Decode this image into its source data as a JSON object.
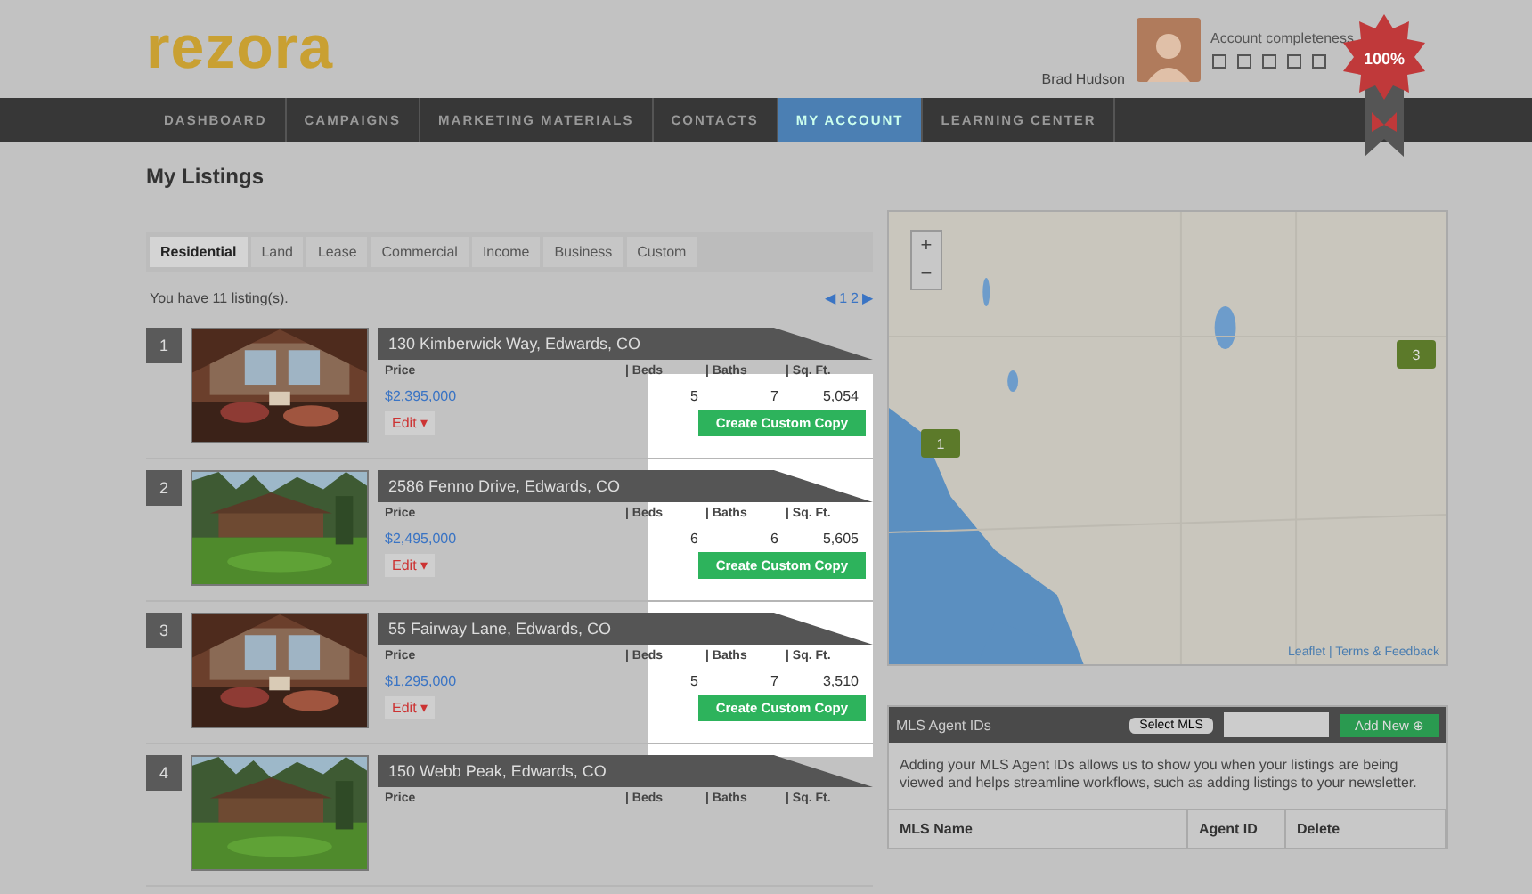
{
  "header": {
    "logo": "rezora",
    "user_name": "Brad Hudson",
    "completeness_label": "Account completeness",
    "badge": "100%"
  },
  "nav": [
    {
      "label": "DASHBOARD",
      "selected": false
    },
    {
      "label": "CAMPAIGNS",
      "selected": false
    },
    {
      "label": "MARKETING MATERIALS",
      "selected": false
    },
    {
      "label": "CONTACTS",
      "selected": false
    },
    {
      "label": "MY ACCOUNT",
      "selected": true
    },
    {
      "label": "LEARNING CENTER",
      "selected": false
    }
  ],
  "page_title": "My Listings",
  "tabs": [
    {
      "label": "Residential",
      "selected": true
    },
    {
      "label": "Land",
      "selected": false
    },
    {
      "label": "Lease",
      "selected": false
    },
    {
      "label": "Commercial",
      "selected": false
    },
    {
      "label": "Income",
      "selected": false
    },
    {
      "label": "Business",
      "selected": false
    },
    {
      "label": "Custom",
      "selected": false
    }
  ],
  "listing_count": "You have 11 listing(s).",
  "pagination": {
    "prev": "◀",
    "pages": [
      "1",
      "2"
    ],
    "next": "▶"
  },
  "listings": [
    {
      "number": "1",
      "address": "130 Kimberwick Way, Edwards, CO",
      "columns": [
        "Price",
        "| Beds",
        "| Baths",
        "| Sq. Ft."
      ],
      "price": "$2,395,000",
      "beds": "5",
      "baths": "7",
      "sqft": "5,054",
      "edit": "Edit ▾",
      "action": "Create Custom Copy"
    },
    {
      "number": "2",
      "address": "2586 Fenno Drive, Edwards, CO",
      "columns": [
        "Price",
        "| Beds",
        "| Baths",
        "| Sq. Ft."
      ],
      "price": "$2,495,000",
      "beds": "6",
      "baths": "6",
      "sqft": "5,605",
      "edit": "Edit ▾",
      "action": "Create Custom Copy"
    },
    {
      "number": "3",
      "address": "55 Fairway Lane, Edwards, CO",
      "columns": [
        "Price",
        "| Beds",
        "| Baths",
        "| Sq. Ft."
      ],
      "price": "$1,295,000",
      "beds": "5",
      "baths": "7",
      "sqft": "3,510",
      "edit": "Edit ▾",
      "action": "Create Custom Copy"
    },
    {
      "number": "4",
      "address": "150 Webb Peak, Edwards, CO",
      "columns": [
        "Price",
        "| Beds",
        "| Baths",
        "| Sq. Ft."
      ]
    }
  ],
  "map": {
    "zoom_in": "+",
    "zoom_out": "−",
    "markers": [
      "1",
      "3"
    ],
    "attribution": "Leaflet | Terms & Feedback"
  },
  "mls": {
    "title": "MLS Agent IDs",
    "select": "Select MLS",
    "add": "Add New ⊕",
    "description": "Adding your MLS Agent IDs allows us to show you when your listings are being viewed and helps streamline workflows, such as adding listings to your newsletter.",
    "columns": [
      "MLS Name",
      "Agent ID",
      "Delete"
    ]
  }
}
